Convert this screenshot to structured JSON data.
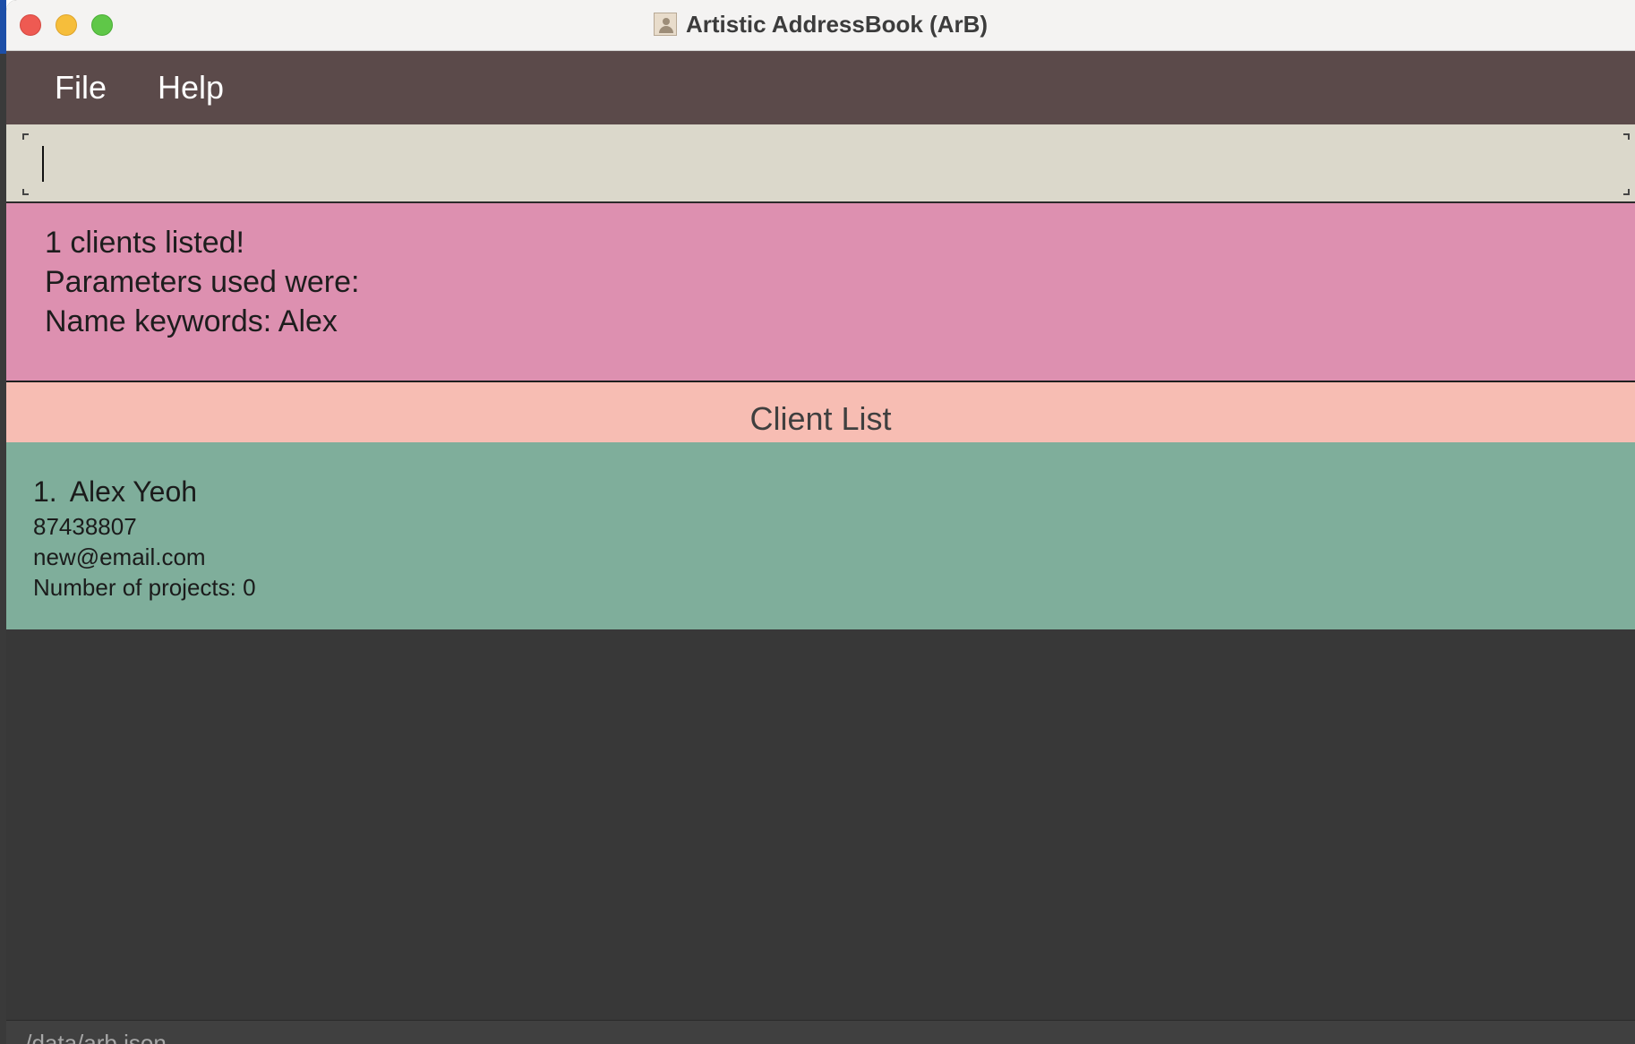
{
  "window": {
    "title": "Artistic AddressBook (ArB)"
  },
  "menu": {
    "file_label": "File",
    "help_label": "Help"
  },
  "command": {
    "value": "",
    "placeholder": ""
  },
  "result": {
    "lines": [
      "1 clients listed!",
      "Parameters used were:",
      "Name keywords: Alex"
    ]
  },
  "client_list": {
    "title": "Client List",
    "clients": [
      {
        "index": "1.",
        "name": "Alex Yeoh",
        "phone": "87438807",
        "email": "new@email.com",
        "projects": "Number of projects: 0"
      }
    ]
  },
  "status": {
    "path": "./data/arb.json"
  },
  "colors": {
    "menubar": "#5b4a4a",
    "command_bg": "#dbd8cb",
    "result_bg": "#dd90b0",
    "list_header_bg": "#f7bdb3",
    "card_bg": "#7fae9b",
    "window_bg": "#383838"
  },
  "icons": {
    "app": "addressbook-icon"
  }
}
